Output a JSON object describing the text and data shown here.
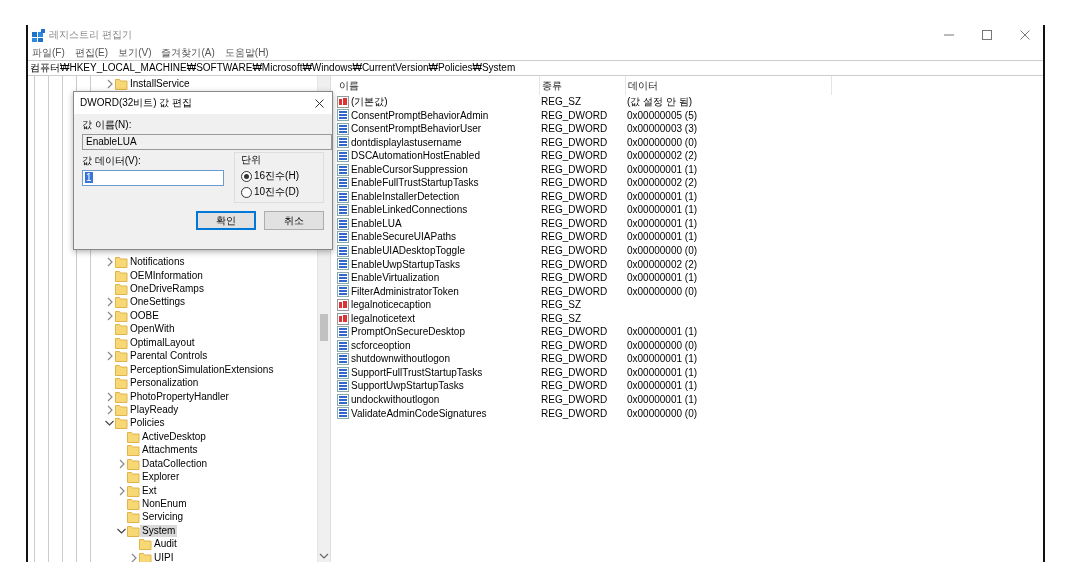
{
  "window": {
    "title": "레지스트리 편집기",
    "controls": [
      {
        "kind": "minimize"
      },
      {
        "kind": "maximize"
      },
      {
        "kind": "close"
      }
    ]
  },
  "menu": [
    "파일(F)",
    "편집(E)",
    "보기(V)",
    "즐겨찾기(A)",
    "도움말(H)"
  ],
  "address": "컴퓨터₩HKEY_LOCAL_MACHINE₩SOFTWARE₩Microsoft₩Windows₩CurrentVersion₩Policies₩System",
  "tree": [
    {
      "label": "InstallService",
      "expanded": false,
      "selected": false
    },
    {
      "label": "Notifications",
      "expanded": false,
      "selected": false
    },
    {
      "label": "OEMInformation",
      "selected": false
    },
    {
      "label": "OneDriveRamps",
      "selected": false
    },
    {
      "label": "OneSettings",
      "expanded": false,
      "selected": false
    },
    {
      "label": "OOBE",
      "expanded": false,
      "selected": false
    },
    {
      "label": "OpenWith",
      "selected": false
    },
    {
      "label": "OptimalLayout",
      "selected": false
    },
    {
      "label": "Parental Controls",
      "expanded": false,
      "selected": false
    },
    {
      "label": "PerceptionSimulationExtensions",
      "selected": false
    },
    {
      "label": "Personalization",
      "selected": false
    },
    {
      "label": "PhotoPropertyHandler",
      "expanded": false,
      "selected": false
    },
    {
      "label": "PlayReady",
      "expanded": false,
      "selected": false
    },
    {
      "label": "Policies",
      "expanded": true,
      "selected": false,
      "children": [
        {
          "label": "ActiveDesktop",
          "selected": false
        },
        {
          "label": "Attachments",
          "selected": false
        },
        {
          "label": "DataCollection",
          "expanded": false,
          "selected": false
        },
        {
          "label": "Explorer",
          "selected": false
        },
        {
          "label": "Ext",
          "expanded": false,
          "selected": false
        },
        {
          "label": "NonEnum",
          "selected": false
        },
        {
          "label": "Servicing",
          "selected": false
        },
        {
          "label": "System",
          "expanded": true,
          "selected": true,
          "children": [
            {
              "label": "Audit",
              "selected": false
            },
            {
              "label": "UIPI",
              "expanded": false,
              "selected": false
            }
          ]
        }
      ]
    }
  ],
  "values": {
    "columns": [
      "이름",
      "종류",
      "데이터"
    ],
    "rows": [
      {
        "kind": "string",
        "name": "(기본값)",
        "type": "REG_SZ",
        "data": "(값 설정 안 됨)"
      },
      {
        "kind": "dword",
        "name": "ConsentPromptBehaviorAdmin",
        "type": "REG_DWORD",
        "data": "0x00000005 (5)"
      },
      {
        "kind": "dword",
        "name": "ConsentPromptBehaviorUser",
        "type": "REG_DWORD",
        "data": "0x00000003 (3)"
      },
      {
        "kind": "dword",
        "name": "dontdisplaylastusername",
        "type": "REG_DWORD",
        "data": "0x00000000 (0)"
      },
      {
        "kind": "dword",
        "name": "DSCAutomationHostEnabled",
        "type": "REG_DWORD",
        "data": "0x00000002 (2)"
      },
      {
        "kind": "dword",
        "name": "EnableCursorSuppression",
        "type": "REG_DWORD",
        "data": "0x00000001 (1)"
      },
      {
        "kind": "dword",
        "name": "EnableFullTrustStartupTasks",
        "type": "REG_DWORD",
        "data": "0x00000002 (2)"
      },
      {
        "kind": "dword",
        "name": "EnableInstallerDetection",
        "type": "REG_DWORD",
        "data": "0x00000001 (1)"
      },
      {
        "kind": "dword",
        "name": "EnableLinkedConnections",
        "type": "REG_DWORD",
        "data": "0x00000001 (1)"
      },
      {
        "kind": "dword",
        "name": "EnableLUA",
        "type": "REG_DWORD",
        "data": "0x00000001 (1)"
      },
      {
        "kind": "dword",
        "name": "EnableSecureUIAPaths",
        "type": "REG_DWORD",
        "data": "0x00000001 (1)"
      },
      {
        "kind": "dword",
        "name": "EnableUIADesktopToggle",
        "type": "REG_DWORD",
        "data": "0x00000000 (0)"
      },
      {
        "kind": "dword",
        "name": "EnableUwpStartupTasks",
        "type": "REG_DWORD",
        "data": "0x00000002 (2)"
      },
      {
        "kind": "dword",
        "name": "EnableVirtualization",
        "type": "REG_DWORD",
        "data": "0x00000001 (1)"
      },
      {
        "kind": "dword",
        "name": "FilterAdministratorToken",
        "type": "REG_DWORD",
        "data": "0x00000000 (0)"
      },
      {
        "kind": "string",
        "name": "legalnoticecaption",
        "type": "REG_SZ"
      },
      {
        "kind": "string",
        "name": "legalnoticetext",
        "type": "REG_SZ"
      },
      {
        "kind": "dword",
        "name": "PromptOnSecureDesktop",
        "type": "REG_DWORD",
        "data": "0x00000001 (1)"
      },
      {
        "kind": "dword",
        "name": "scforceoption",
        "type": "REG_DWORD",
        "data": "0x00000000 (0)"
      },
      {
        "kind": "dword",
        "name": "shutdownwithoutlogon",
        "type": "REG_DWORD",
        "data": "0x00000001 (1)"
      },
      {
        "kind": "dword",
        "name": "SupportFullTrustStartupTasks",
        "type": "REG_DWORD",
        "data": "0x00000001 (1)"
      },
      {
        "kind": "dword",
        "name": "SupportUwpStartupTasks",
        "type": "REG_DWORD",
        "data": "0x00000001 (1)"
      },
      {
        "kind": "dword",
        "name": "undockwithoutlogon",
        "type": "REG_DWORD",
        "data": "0x00000001 (1)"
      },
      {
        "kind": "dword",
        "name": "ValidateAdminCodeSignatures",
        "type": "REG_DWORD",
        "data": "0x00000000 (0)"
      }
    ]
  },
  "dialog": {
    "title": "DWORD(32비트) 값 편집",
    "name_label": "값 이름(N):",
    "name_value": "EnableLUA",
    "data_label": "값 데이터(V):",
    "data_value": "1",
    "base_group": "단위",
    "bases": [
      {
        "label": "16진수(H)",
        "selected": true
      },
      {
        "label": "10진수(D)",
        "selected": false
      }
    ],
    "buttons": [
      {
        "label": "확인",
        "default": true
      },
      {
        "label": "취소",
        "default": false
      }
    ]
  }
}
